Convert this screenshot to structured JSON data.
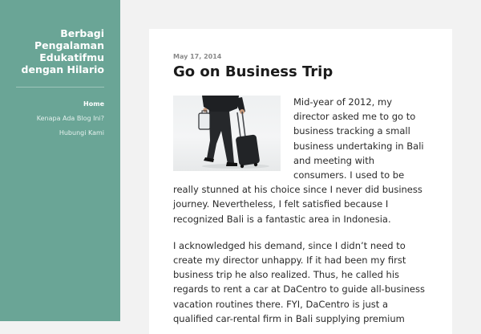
{
  "site": {
    "title": "Berbagi Pengalaman Edukatifmu dengan Hilario"
  },
  "nav": {
    "items": [
      {
        "label": "Home",
        "active": true
      },
      {
        "label": "Kenapa Ada Blog Ini?",
        "active": false
      },
      {
        "label": "Hubungi Kami",
        "active": false
      }
    ]
  },
  "post": {
    "date": "May 17, 2014",
    "title": "Go on Business Trip",
    "image_icon": "businessman-with-suitcase-photo",
    "paragraphs": [
      "Mid-year of 2012, my director asked me to go to business tracking a small business undertaking in Bali and meeting with consumers. I used to be really stunned at his choice since I never did business journey. Nevertheless, I felt satisfied because I recognized Bali is a fantastic area in Indonesia.",
      "I acknowledged his demand, since I didn’t need to create my director unhappy. If it had been my first business trip he also realized. Thus, he called his regards to rent a car at DaCentro to guide all-business vacation routines there. FYI, DaCentro is just a qualified car-rental firm in Bali supplying premium"
    ]
  },
  "colors": {
    "sidebar": "#6aa596",
    "background": "#f2f2f2",
    "content": "#ffffff"
  }
}
